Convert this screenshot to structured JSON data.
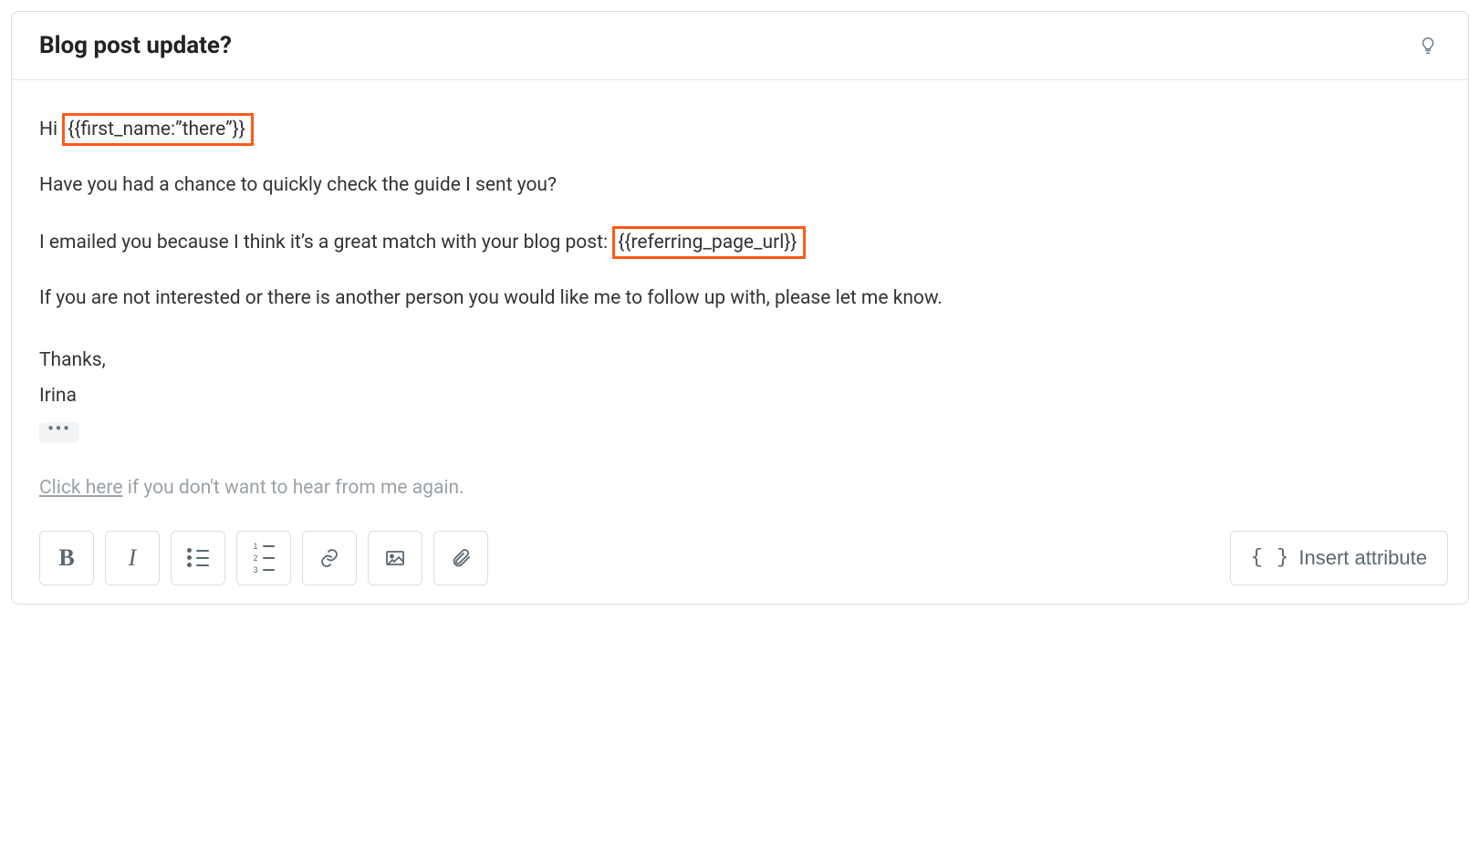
{
  "subject": "Blog post update?",
  "body": {
    "greeting_prefix": "Hi ",
    "greeting_placeholder": "{{first_name:”there”}}",
    "line1": "Have you had a chance to quickly check the guide I sent you?",
    "line2_prefix": "I emailed you because I think it’s a great match with your blog post: ",
    "line2_placeholder": "{{referring_page_url}}",
    "line3": "If you are not interested or there is another person you would like me to follow up with, please let me know.",
    "signoff1": "Thanks,",
    "signoff2": "Irina"
  },
  "unsubscribe": {
    "link_text": "Click here",
    "rest": " if you don't want to hear from me again."
  },
  "toolbar": {
    "bold": "B",
    "italic": "I",
    "insert_attribute": "Insert attribute",
    "braces": "{ }"
  },
  "highlight_color": "#ff5a1a"
}
